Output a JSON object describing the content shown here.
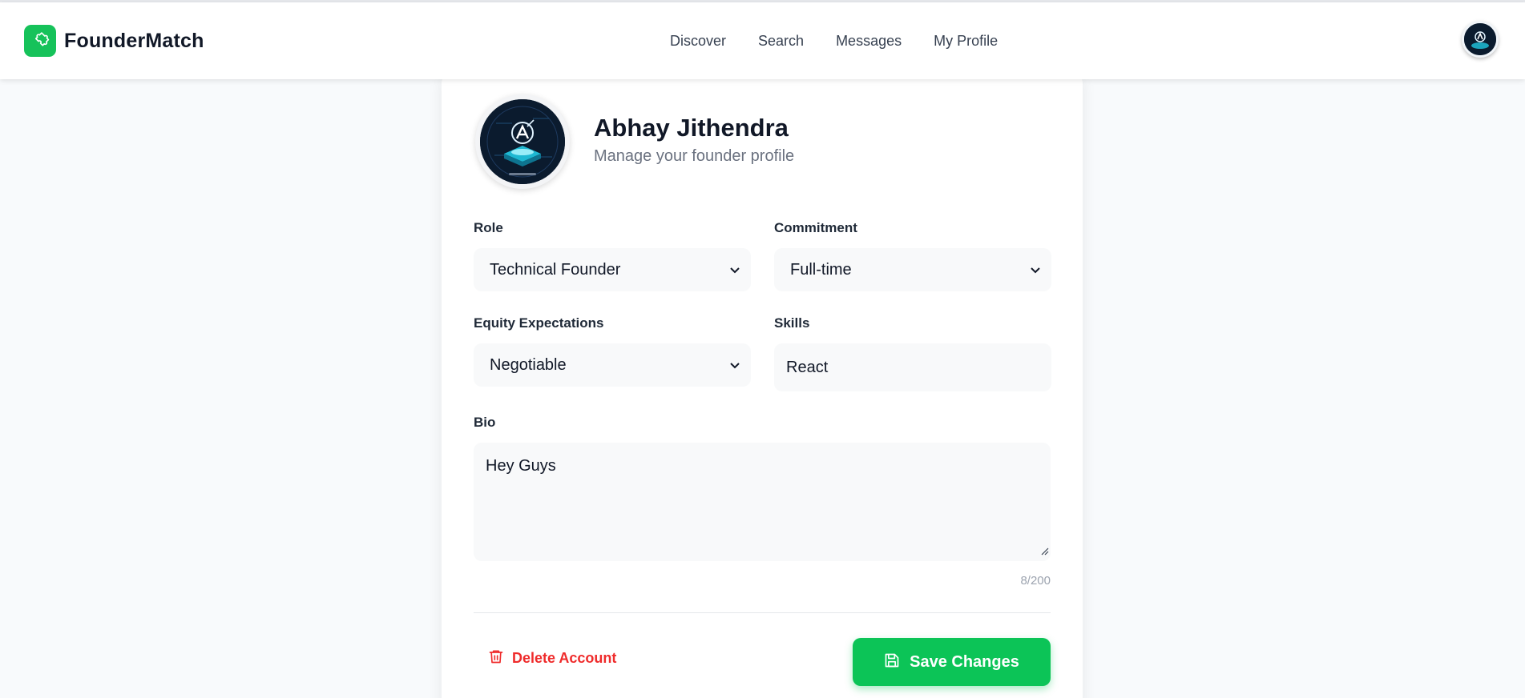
{
  "app": {
    "name": "FounderMatch",
    "accent_color": "#16c25a"
  },
  "nav": {
    "items": [
      {
        "label": "Discover"
      },
      {
        "label": "Search"
      },
      {
        "label": "Messages"
      },
      {
        "label": "My Profile"
      }
    ]
  },
  "profile": {
    "name": "Abhay Jithendra",
    "subtitle": "Manage your founder profile",
    "avatar_icon": "robot-avatar-icon"
  },
  "form": {
    "role": {
      "label": "Role",
      "value": "Technical Founder"
    },
    "commitment": {
      "label": "Commitment",
      "value": "Full-time"
    },
    "equity": {
      "label": "Equity Expectations",
      "value": "Negotiable"
    },
    "skills": {
      "label": "Skills",
      "value": "React"
    },
    "bio": {
      "label": "Bio",
      "value": "Hey Guys",
      "counter": "8/200"
    }
  },
  "actions": {
    "delete_label": "Delete Account",
    "save_label": "Save Changes",
    "delete_color": "#ef2b2b",
    "save_color": "#0cc457"
  }
}
